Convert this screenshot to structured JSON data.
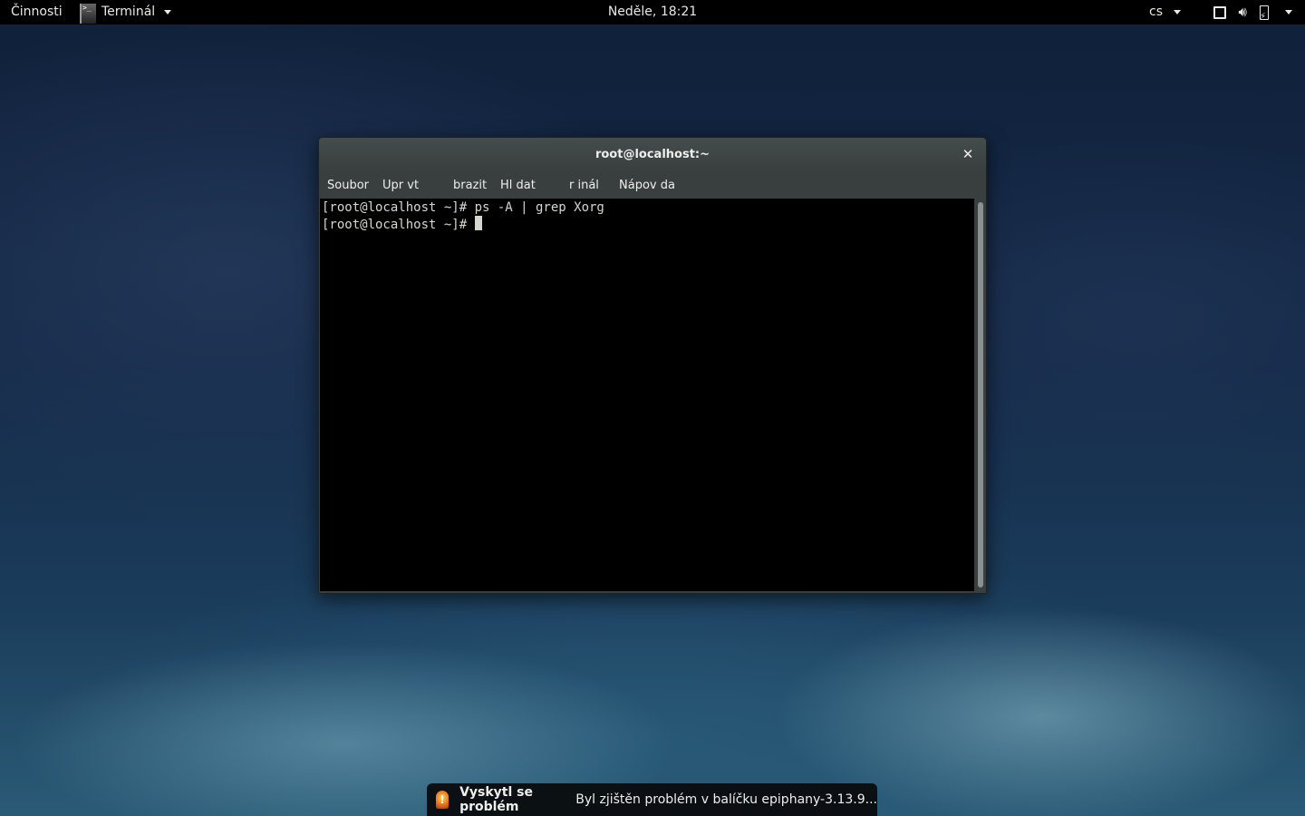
{
  "topbar": {
    "activities": "Činnosti",
    "app_name": "Terminál",
    "clock": "Neděle, 18:21",
    "language": "cs",
    "tray_icons": [
      "window-icon",
      "volume-icon",
      "battery-icon",
      "system-menu-arrow-icon"
    ]
  },
  "window": {
    "title": "root@localhost:~",
    "menu": [
      "Soubor",
      "Upr vt",
      "brazit",
      "Hl dat",
      "r inál",
      "Nápov da"
    ],
    "terminal_lines": [
      "[root@localhost ~]# ps -A | grep Xorg",
      "[root@localhost ~]# "
    ]
  },
  "notification": {
    "title": "Vyskytl se problém",
    "body": "Byl zjištěn problém v balíčku epiphany-3.13.9..."
  }
}
